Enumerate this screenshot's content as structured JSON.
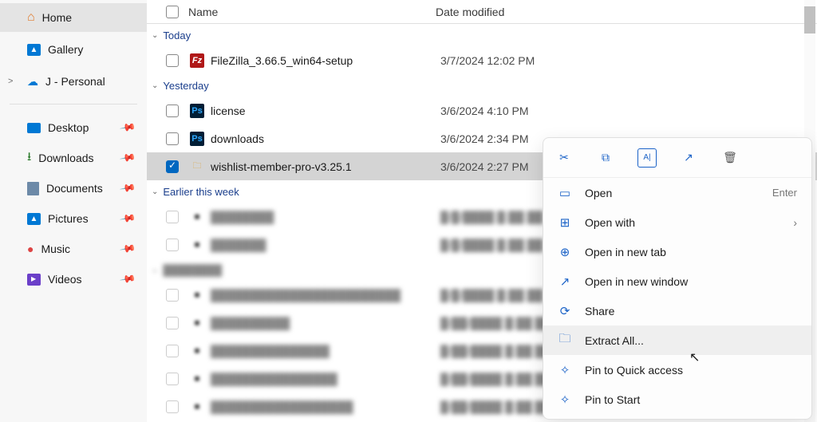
{
  "sidebar": {
    "top": [
      {
        "label": "Home",
        "icon": "home-icon"
      },
      {
        "label": "Gallery",
        "icon": "gallery-icon"
      },
      {
        "label": "J - Personal",
        "icon": "cloud-icon",
        "chevron": ">"
      }
    ],
    "quick": [
      {
        "label": "Desktop",
        "icon": "desktop-icon"
      },
      {
        "label": "Downloads",
        "icon": "downloads-icon"
      },
      {
        "label": "Documents",
        "icon": "documents-icon"
      },
      {
        "label": "Pictures",
        "icon": "pictures-icon"
      },
      {
        "label": "Music",
        "icon": "music-icon"
      },
      {
        "label": "Videos",
        "icon": "videos-icon"
      }
    ]
  },
  "columns": {
    "name": "Name",
    "date": "Date modified"
  },
  "groups": [
    {
      "label": "Today",
      "items": [
        {
          "name": "FileZilla_3.66.5_win64-setup",
          "date": "3/7/2024 12:02 PM",
          "icon": "filezilla-icon"
        }
      ]
    },
    {
      "label": "Yesterday",
      "items": [
        {
          "name": "license",
          "date": "3/6/2024 4:10 PM",
          "icon": "photoshop-icon"
        },
        {
          "name": "downloads",
          "date": "3/6/2024 2:34 PM",
          "icon": "photoshop-icon"
        },
        {
          "name": "wishlist-member-pro-v3.25.1",
          "date": "3/6/2024 2:27 PM",
          "icon": "folder-icon",
          "selected": true
        }
      ]
    },
    {
      "label": "Earlier this week",
      "items": [
        {
          "name": "████████",
          "date": "█/█/████ █:██ ██",
          "blurred": true
        },
        {
          "name": "███████",
          "date": "█/█/████ █:██ ██",
          "blurred": true
        }
      ]
    },
    {
      "label": "████████",
      "blurred_label": true,
      "items": [
        {
          "name": "████████████████████████",
          "date": "█/█/████ █:██ ██",
          "blurred": true
        },
        {
          "name": "██████████",
          "date": "█/██/████ █:██ ██",
          "blurred": true
        },
        {
          "name": "███████████████",
          "date": "█/██/████ █:██ ██",
          "blurred": true
        },
        {
          "name": "████████████████",
          "date": "█/██/████ █:██ ██",
          "blurred": true
        },
        {
          "name": "██████████████████",
          "date": "█/██/████ █:██ ██",
          "blurred": true
        }
      ]
    }
  ],
  "context_menu": {
    "toolbar": [
      "cut-icon",
      "copy-icon",
      "rename-icon",
      "share-icon",
      "delete-icon"
    ],
    "items": [
      {
        "label": "Open",
        "icon": "open-icon",
        "accel": "Enter"
      },
      {
        "label": "Open with",
        "icon": "open-with-icon",
        "submenu": true
      },
      {
        "label": "Open in new tab",
        "icon": "new-tab-icon"
      },
      {
        "label": "Open in new window",
        "icon": "new-window-icon"
      },
      {
        "label": "Share",
        "icon": "share-arrow-icon"
      },
      {
        "label": "Extract All...",
        "icon": "extract-icon",
        "hover": true
      },
      {
        "label": "Pin to Quick access",
        "icon": "pin-icon"
      },
      {
        "label": "Pin to Start",
        "icon": "pin-start-icon"
      }
    ]
  }
}
